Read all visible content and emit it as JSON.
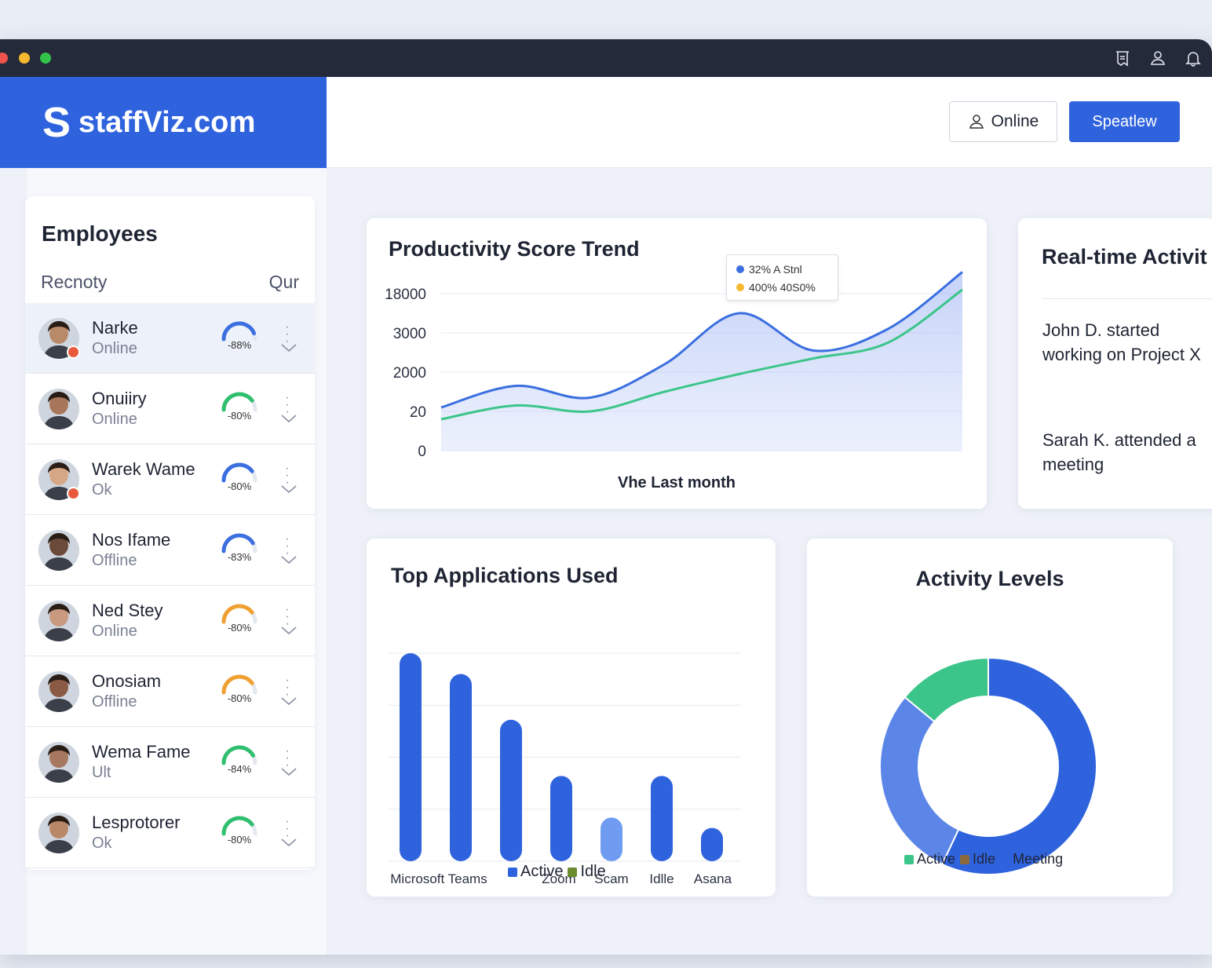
{
  "brand": {
    "logo": "S",
    "name": "staffViz.com"
  },
  "header": {
    "online_label": "Online",
    "primary_button": "Speatlew"
  },
  "employees": {
    "title": "Employees",
    "col_left": "Recnoty",
    "col_right": "Qur",
    "rows": [
      {
        "name": "Narke",
        "status": "Online",
        "score": "-88%",
        "score_value": 0.88,
        "gauge_color": "#3b6fe0",
        "badge": true,
        "skin": "#b98a6a"
      },
      {
        "name": "Onuiiry",
        "status": "Online",
        "score": "-80%",
        "score_value": 0.8,
        "gauge_color": "#2fbf6e",
        "badge": false,
        "skin": "#a8765a"
      },
      {
        "name": "Warek Wame",
        "status": "Ok",
        "score": "-80%",
        "score_value": 0.8,
        "gauge_color": "#3b6fe0",
        "badge": true,
        "skin": "#d6a787"
      },
      {
        "name": "Nos Ifame",
        "status": "Offline",
        "score": "-83%",
        "score_value": 0.83,
        "gauge_color": "#3b6fe0",
        "badge": false,
        "skin": "#6b4a3a"
      },
      {
        "name": "Ned Stey",
        "status": "Online",
        "score": "-80%",
        "score_value": 0.8,
        "gauge_color": "#f0a030",
        "badge": false,
        "skin": "#c99a80"
      },
      {
        "name": "Onosiam",
        "status": "Offline",
        "score": "-80%",
        "score_value": 0.8,
        "gauge_color": "#f0a030",
        "badge": false,
        "skin": "#8a5a44"
      },
      {
        "name": "Wema Fame",
        "status": "Ult",
        "score": "-84%",
        "score_value": 0.84,
        "gauge_color": "#2fbf6e",
        "badge": false,
        "skin": "#a67860"
      },
      {
        "name": "Lesprotorer",
        "status": "Ok",
        "score": "-80%",
        "score_value": 0.8,
        "gauge_color": "#2fbf6e",
        "badge": false,
        "skin": "#b88868"
      }
    ]
  },
  "productivity": {
    "title": "Productivity Score Trend",
    "xlabel": "Vhe Last month",
    "tooltip": {
      "line1": "32% A Stnl",
      "line2": "400% 40S0%",
      "color1": "#3b6fe0",
      "color2": "#f5b82e"
    }
  },
  "realtime": {
    "title": "Real-time Activit",
    "items": [
      "John D. started working on Project X",
      "Sarah K. attended a meeting"
    ]
  },
  "apps": {
    "title": "Top Applications Used",
    "legend": [
      {
        "label": "Active",
        "color": "#2f63de"
      },
      {
        "label": "Idle",
        "color": "#6a8c2e"
      }
    ]
  },
  "activity": {
    "title": "Activity Levels",
    "legend": [
      {
        "label": "Active",
        "color": "#3cc58a"
      },
      {
        "label": "Idle",
        "color": "#8a6a3a"
      },
      {
        "label": "Meeting",
        "color": "#2f63de"
      }
    ]
  },
  "chart_data": [
    {
      "type": "line",
      "title": "Productivity Score Trend",
      "xlabel": "Vhe Last month",
      "ylabel": "",
      "yticks": [
        "0",
        "20",
        "2000",
        "3000",
        "18000"
      ],
      "series": [
        {
          "color": "#3b6fe0",
          "values": [
            1.1,
            1.65,
            1.35,
            2.2,
            3.5,
            2.55,
            3.1,
            4.55
          ]
        },
        {
          "color": "#3cc58a",
          "values": [
            0.8,
            1.15,
            1.0,
            1.5,
            1.95,
            2.35,
            2.75,
            4.1
          ]
        }
      ],
      "tooltip_visible": true,
      "grid": true
    },
    {
      "type": "bar",
      "title": "Top Applications Used",
      "categories": [
        "Microsoft Teams",
        "",
        "",
        "Zoom",
        "Scam",
        "Idlle",
        "Asana"
      ],
      "values": [
        100,
        90,
        68,
        41,
        21,
        41,
        16
      ],
      "colors": [
        "#2f63de",
        "#2f63de",
        "#2f63de",
        "#2f63de",
        "#6f9cf0",
        "#2f63de",
        "#2f63de"
      ],
      "grid": true
    },
    {
      "type": "pie",
      "title": "Activity Levels",
      "donut": true,
      "slices": [
        {
          "label": "Meeting",
          "value": 57,
          "color": "#2f63de"
        },
        {
          "label": "Idle",
          "value": 29,
          "color": "#5b86e8"
        },
        {
          "label": "Active",
          "value": 14,
          "color": "#3cc58a"
        }
      ]
    }
  ]
}
